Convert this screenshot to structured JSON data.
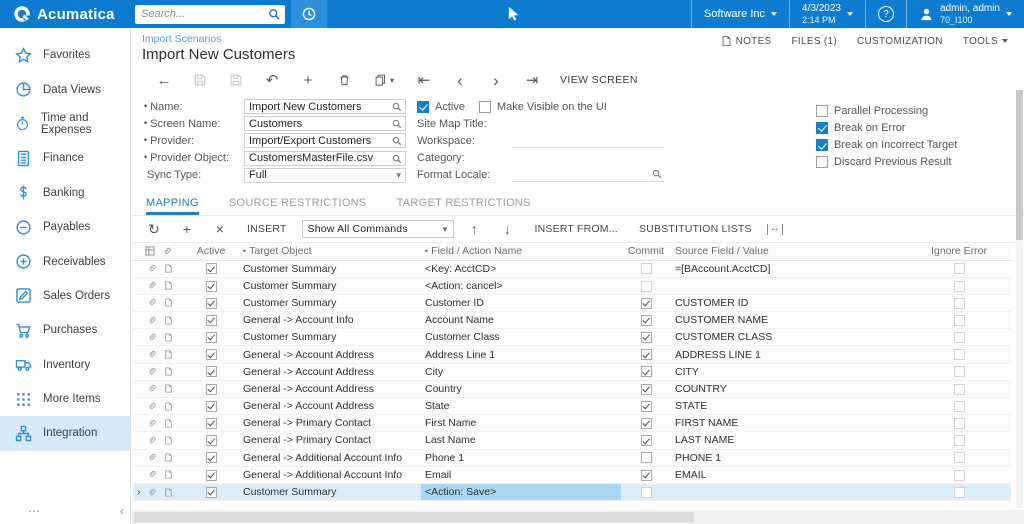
{
  "topbar": {
    "brand": "Acumatica",
    "search_placeholder": "Search...",
    "company": "Software Inc",
    "date": "4/3/2023",
    "time": "2:14 PM",
    "user_name": "admin, admin",
    "user_tenant": "70_I100"
  },
  "sidebar": {
    "items": [
      {
        "label": "Favorites",
        "icon": "star",
        "active": false
      },
      {
        "label": "Data Views",
        "icon": "pie",
        "active": false
      },
      {
        "label": "Time and Expenses",
        "icon": "stopwatch",
        "active": false
      },
      {
        "label": "Finance",
        "icon": "calculator",
        "active": false
      },
      {
        "label": "Banking",
        "icon": "dollar",
        "active": false
      },
      {
        "label": "Payables",
        "icon": "minus-circle",
        "active": false
      },
      {
        "label": "Receivables",
        "icon": "plus-circle",
        "active": false
      },
      {
        "label": "Sales Orders",
        "icon": "pencil",
        "active": false
      },
      {
        "label": "Purchases",
        "icon": "cart",
        "active": false
      },
      {
        "label": "Inventory",
        "icon": "truck",
        "active": false
      },
      {
        "label": "More Items",
        "icon": "grid-dots",
        "active": false
      },
      {
        "label": "Integration",
        "icon": "org-chart",
        "active": true
      }
    ]
  },
  "header": {
    "breadcrumb": "Import Scenarios",
    "title": "Import New Customers",
    "notes": "NOTES",
    "files": "FILES (1)",
    "customization": "CUSTOMIZATION",
    "tools": "TOOLS"
  },
  "toolbar": {
    "view_screen": "VIEW SCREEN"
  },
  "form": {
    "fields_left": [
      {
        "label": "Name:",
        "required": true,
        "value": "Import New Customers",
        "control": "lookup"
      },
      {
        "label": "Screen Name:",
        "required": true,
        "value": "Customers",
        "control": "lookup"
      },
      {
        "label": "Provider:",
        "required": true,
        "value": "Import/Export Customers",
        "control": "lookup"
      },
      {
        "label": "Provider Object:",
        "required": true,
        "value": "CustomersMasterFile.csv",
        "control": "lookup"
      },
      {
        "label": "Sync Type:",
        "required": false,
        "value": "Full",
        "control": "dropdown"
      }
    ],
    "checkboxes_top": [
      {
        "label": "Active",
        "checked": true
      },
      {
        "label": "Make Visible on the UI",
        "checked": false
      }
    ],
    "fields_middle": [
      {
        "label": "Site Map Title:",
        "value": "",
        "underline": false,
        "lookup": false
      },
      {
        "label": "Workspace:",
        "value": "",
        "underline": true,
        "lookup": false
      },
      {
        "label": "Category:",
        "value": "",
        "underline": false,
        "lookup": false
      },
      {
        "label": "Format Locale:",
        "value": "",
        "underline": true,
        "lookup": true
      }
    ],
    "checkboxes_right": [
      {
        "label": "Parallel Processing",
        "checked": false
      },
      {
        "label": "Break on Error",
        "checked": true
      },
      {
        "label": "Break on Incorrect Target",
        "checked": true
      },
      {
        "label": "Discard Previous Result",
        "checked": false
      }
    ]
  },
  "tabs": [
    {
      "label": "MAPPING",
      "active": true
    },
    {
      "label": "SOURCE RESTRICTIONS",
      "active": false
    },
    {
      "label": "TARGET RESTRICTIONS",
      "active": false
    }
  ],
  "grid_toolbar": {
    "insert_label": "INSERT",
    "commands_value": "Show All Commands",
    "insert_from_label": "INSERT FROM...",
    "substitution_label": "SUBSTITUTION LISTS"
  },
  "grid": {
    "columns": {
      "active": "Active",
      "target": "Target Object",
      "field": "Field / Action Name",
      "commit": "Commit",
      "source": "Source Field / Value",
      "ignore": "Ignore Error"
    },
    "rows": [
      {
        "active": true,
        "target": "Customer Summary",
        "field": "<Key: AcctCD>",
        "commit": "disabled",
        "source": "=[BAccount.AcctCD]",
        "ignore": false,
        "selected": false
      },
      {
        "active": true,
        "target": "Customer Summary",
        "field": "<Action: cancel>",
        "commit": "disabled",
        "source": "",
        "ignore": false,
        "selected": false
      },
      {
        "active": true,
        "target": "Customer Summary",
        "field": "Customer ID",
        "commit": "checked",
        "source": "CUSTOMER ID",
        "ignore": false,
        "selected": false
      },
      {
        "active": true,
        "target": "General -> Account Info",
        "field": "Account Name",
        "commit": "checked",
        "source": "CUSTOMER NAME",
        "ignore": false,
        "selected": false
      },
      {
        "active": true,
        "target": "Customer Summary",
        "field": "Customer Class",
        "commit": "checked",
        "source": "CUSTOMER CLASS",
        "ignore": false,
        "selected": false
      },
      {
        "active": true,
        "target": "General -> Account Address",
        "field": "Address Line 1",
        "commit": "checked",
        "source": "ADDRESS LINE 1",
        "ignore": false,
        "selected": false
      },
      {
        "active": true,
        "target": "General -> Account Address",
        "field": "City",
        "commit": "checked",
        "source": "CITY",
        "ignore": false,
        "selected": false
      },
      {
        "active": true,
        "target": "General -> Account Address",
        "field": "Country",
        "commit": "checked",
        "source": "COUNTRY",
        "ignore": false,
        "selected": false
      },
      {
        "active": true,
        "target": "General -> Account Address",
        "field": "State",
        "commit": "checked",
        "source": "STATE",
        "ignore": false,
        "selected": false
      },
      {
        "active": true,
        "target": "General -> Primary Contact",
        "field": "First Name",
        "commit": "checked",
        "source": "FIRST NAME",
        "ignore": false,
        "selected": false
      },
      {
        "active": true,
        "target": "General -> Primary Contact",
        "field": "Last Name",
        "commit": "checked",
        "source": "LAST NAME",
        "ignore": false,
        "selected": false
      },
      {
        "active": true,
        "target": "General -> Additional Account Info",
        "field": "Phone 1",
        "commit": "unchecked",
        "source": "PHONE 1",
        "ignore": false,
        "selected": false
      },
      {
        "active": true,
        "target": "General -> Additional Account Info",
        "field": "Email",
        "commit": "checked",
        "source": "EMAIL",
        "ignore": false,
        "selected": false
      },
      {
        "active": true,
        "target": "Customer Summary",
        "field": "<Action: Save>",
        "commit": "disabled",
        "source": "",
        "ignore": false,
        "selected": true
      }
    ]
  },
  "glyphs": {
    "back": "←",
    "undo": "↶",
    "plus": "+",
    "times": "×",
    "refresh": "↻",
    "up": "↑",
    "down": "↓",
    "first": "⇤",
    "prev": "‹",
    "next": "›",
    "last": "⇥",
    "caret_down": "▾",
    "fit": "↔",
    "ellipsis": "⋯",
    "collapse": "‹",
    "row_indicator": "›",
    "help": "?",
    "req": "•"
  },
  "colors": {
    "topbar_blue": "#0d7bd0",
    "tile_blue": "#2e90dc",
    "accent_blue": "#1a7fc4",
    "sidebar_active": "#d7eaf8",
    "row_selected": "#ddeefa",
    "cell_selected": "#a9d7f3",
    "breadcrumb_link": "#55a2d8",
    "required_red": "#cf4436"
  }
}
